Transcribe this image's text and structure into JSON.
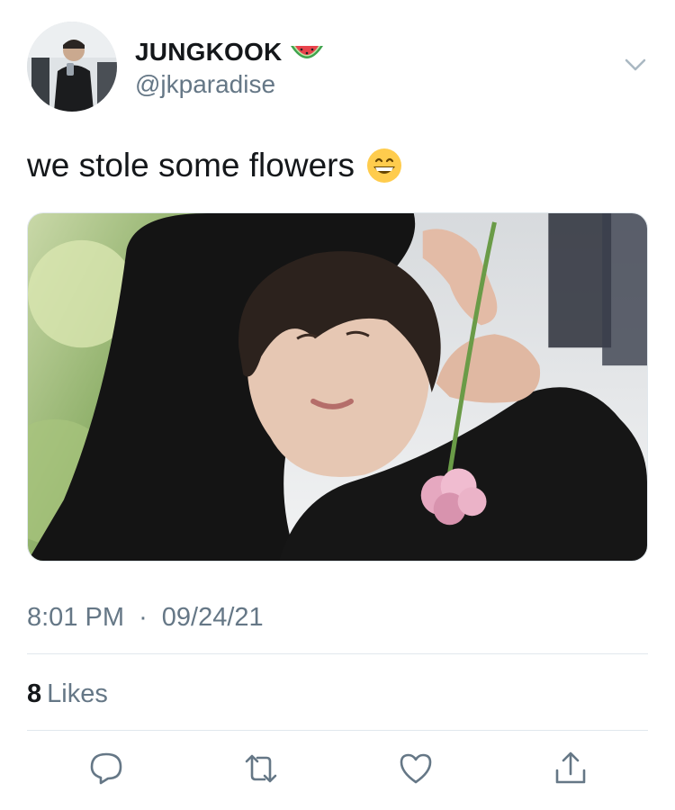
{
  "author": {
    "display_name": "JUNGKOOK",
    "name_emoji": "watermelon-emoji",
    "handle": "@jkparadise"
  },
  "tweet": {
    "text": "we stole some flowers",
    "text_emoji": "grinning-face-emoji",
    "time": "8:01 PM",
    "separator": "·",
    "date": "09/24/21"
  },
  "stats": {
    "likes_count": "8",
    "likes_label": "Likes"
  },
  "icons": {
    "menu": "chevron-down-icon",
    "reply": "reply-icon",
    "retweet": "retweet-icon",
    "like": "heart-icon",
    "share": "share-icon"
  },
  "colors": {
    "text_primary": "#14171a",
    "text_secondary": "#657786",
    "divider": "#e1e8ed"
  }
}
